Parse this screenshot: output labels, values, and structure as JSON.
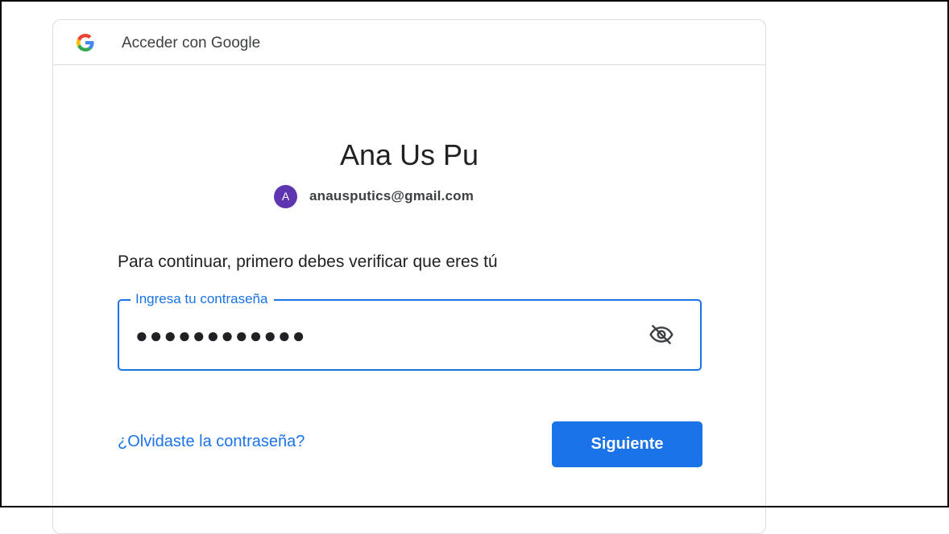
{
  "header": {
    "logo_icon": "google-g-icon",
    "title": "Acceder con Google"
  },
  "account": {
    "name": "Ana Us Pu",
    "avatar_letter": "A",
    "avatar_color": "#5e35b1",
    "email": "anausputics@gmail.com"
  },
  "form": {
    "prompt": "Para continuar, primero debes verificar que eres tú",
    "password_label": "Ingresa tu contraseña",
    "password_value": "●●●●●●●●●●●●",
    "visibility_icon": "eye-off-icon",
    "forgot_link": "¿Olvidaste la contraseña?",
    "next_label": "Siguiente"
  },
  "colors": {
    "accent": "#1a73e8",
    "border": "#dadce0"
  }
}
